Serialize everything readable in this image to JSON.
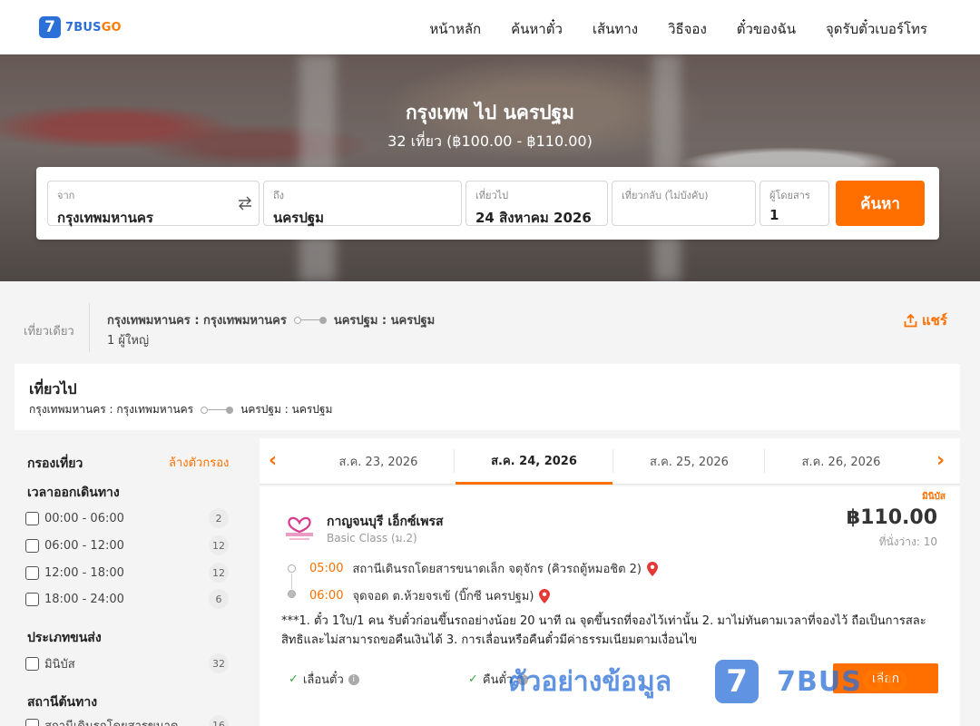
{
  "header": {
    "logo_mark": "7",
    "logo_text_a": "7BUS",
    "logo_text_b": "GO",
    "nav": [
      "หน้าหลัก",
      "ค้นหาตั๋ว",
      "เส้นทาง",
      "วิธีจอง",
      "ตั๋วของฉัน",
      "จุดรับตั๋วเบอร์โทร"
    ]
  },
  "hero": {
    "title": "กรุงเทพ ไป นครปฐม",
    "subtitle": "32 เที่ยว (฿100.00 - ฿110.00)"
  },
  "search": {
    "from_label": "จาก",
    "from_value": "กรุงเทพมหานคร",
    "to_label": "ถึง",
    "to_value": "นครปฐม",
    "depart_label": "เที่ยวไป",
    "depart_value": "24 สิงหาคม 2026",
    "return_label": "เที่ยวกลับ (ไม่บังคับ)",
    "pax_label": "ผู้โดยสาร",
    "pax_value": "1",
    "button": "ค้นหา",
    "swap_icon": "swap-arrows-icon"
  },
  "summary": {
    "trip_type": "เที่ยวเดียว",
    "from": "กรุงเทพมหานคร : กรุงเทพมหานคร",
    "to": "นครปฐม : นครปฐม",
    "pax": "1 ผู้ใหญ่",
    "share": "แชร์"
  },
  "outbound": {
    "title": "เที่ยวไป",
    "from": "กรุงเทพมหานคร : กรุงเทพมหานคร",
    "to": "นครปฐม : นครปฐม"
  },
  "filters": {
    "title": "กรองเที่ยว",
    "clear": "ล้างตัวกรอง",
    "time_section": "เวลาออกเดินทาง",
    "times": [
      {
        "label": "00:00 - 06:00",
        "count": "2"
      },
      {
        "label": "06:00 - 12:00",
        "count": "12"
      },
      {
        "label": "12:00 - 18:00",
        "count": "12"
      },
      {
        "label": "18:00 - 24:00",
        "count": "6"
      }
    ],
    "type_section": "ประเภทขนส่ง",
    "types": [
      {
        "label": "มินิบัส",
        "count": "32"
      }
    ],
    "origin_section": "สถานีต้นทาง",
    "origins": [
      {
        "label": "สถานีเดินรถโดยสารขนาด",
        "count": "16"
      }
    ]
  },
  "dates": {
    "tabs": [
      "ส.ค. 23, 2026",
      "ส.ค. 24, 2026",
      "ส.ค. 25, 2026",
      "ส.ค. 26, 2026"
    ],
    "active_index": 1
  },
  "result": {
    "badge": "มินิบัส",
    "operator": "กาญจนบุรี เอ็กซ์เพรส",
    "class": "Basic Class (ม.2)",
    "price": "฿110.00",
    "seats": "ที่นั่งว่าง: 10",
    "depart_time": "05:00",
    "depart_place": "สถานีเดินรถโดยสารขนาดเล็ก จตุจักร (คิวรถตู้หมอชิต 2)",
    "arrive_time": "06:00",
    "arrive_place": "จุดจอด ต.ห้วยจรเข้ (บิ๊กซี นครปฐม)",
    "notice": "***1. ตั๋ว 1ใบ/1 คน รับตั๋วก่อนขึ้นรถอย่างน้อย 20 นาที ณ จุดขึ้นรถที่จองไว้เท่านั้น 2. มาไม่ทันตามเวลาที่จองไว้ ถือเป็นการสละสิทธิและไม่สามารถขอคืนเงินได้ 3. การเลื่อนหรือคืนตั๋วมีค่าธรรมเนียมตามเงื่อนไข",
    "feature1": "เลื่อนตั๋ว",
    "feature2": "คืนตั๋ว",
    "select": "เลือก"
  },
  "watermark": {
    "text": "ตัวอย่างข้อมูล",
    "mark": "7",
    "brand_a": "7BUS",
    "brand_b": "GO"
  },
  "colors": {
    "accent": "#ff6f00",
    "brand": "#2b6fd8"
  }
}
